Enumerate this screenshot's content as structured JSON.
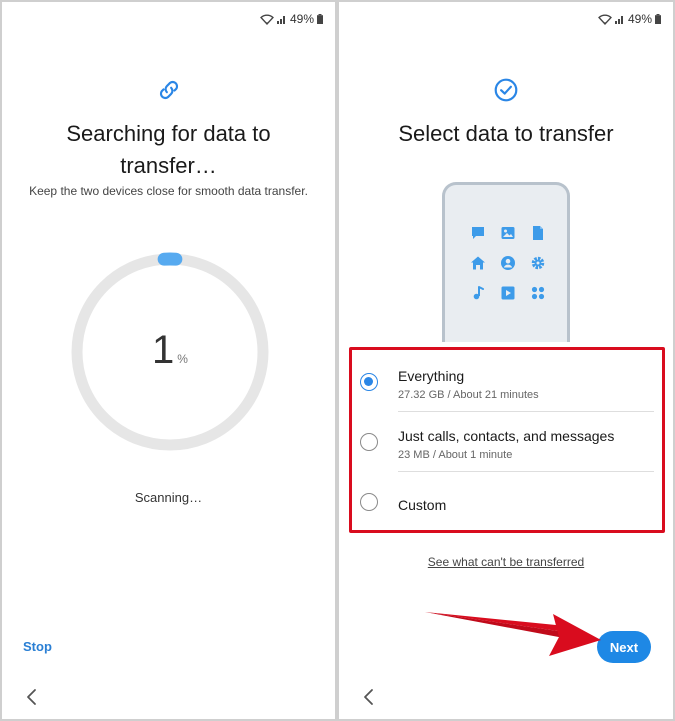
{
  "status_bar": {
    "battery_text": "49%"
  },
  "left_screen": {
    "title": "Searching for data to transfer…",
    "subtitle": "Keep the two devices close for smooth data transfer.",
    "progress": {
      "value": "1",
      "unit": "%",
      "fraction": 0.01
    },
    "scanning_text": "Scanning…",
    "stop_label": "Stop"
  },
  "right_screen": {
    "title": "Select data to transfer",
    "options": [
      {
        "title": "Everything",
        "detail": "27.32 GB / About 21 minutes",
        "selected": true
      },
      {
        "title": "Just calls, contacts, and messages",
        "detail": "23 MB / About 1 minute",
        "selected": false
      },
      {
        "title": "Custom",
        "detail": "",
        "selected": false
      }
    ],
    "link_text": "See what can't be transferred",
    "next_label": "Next"
  },
  "colors": {
    "accent": "#1e88e5",
    "highlight": "#d90c1e",
    "ring": "#e6e6e6"
  },
  "icons": {
    "phone_grid": [
      "chat-icon",
      "image-icon",
      "document-icon",
      "home-icon",
      "contact-icon",
      "settings-icon",
      "music-icon",
      "video-icon",
      "apps-icon"
    ]
  }
}
